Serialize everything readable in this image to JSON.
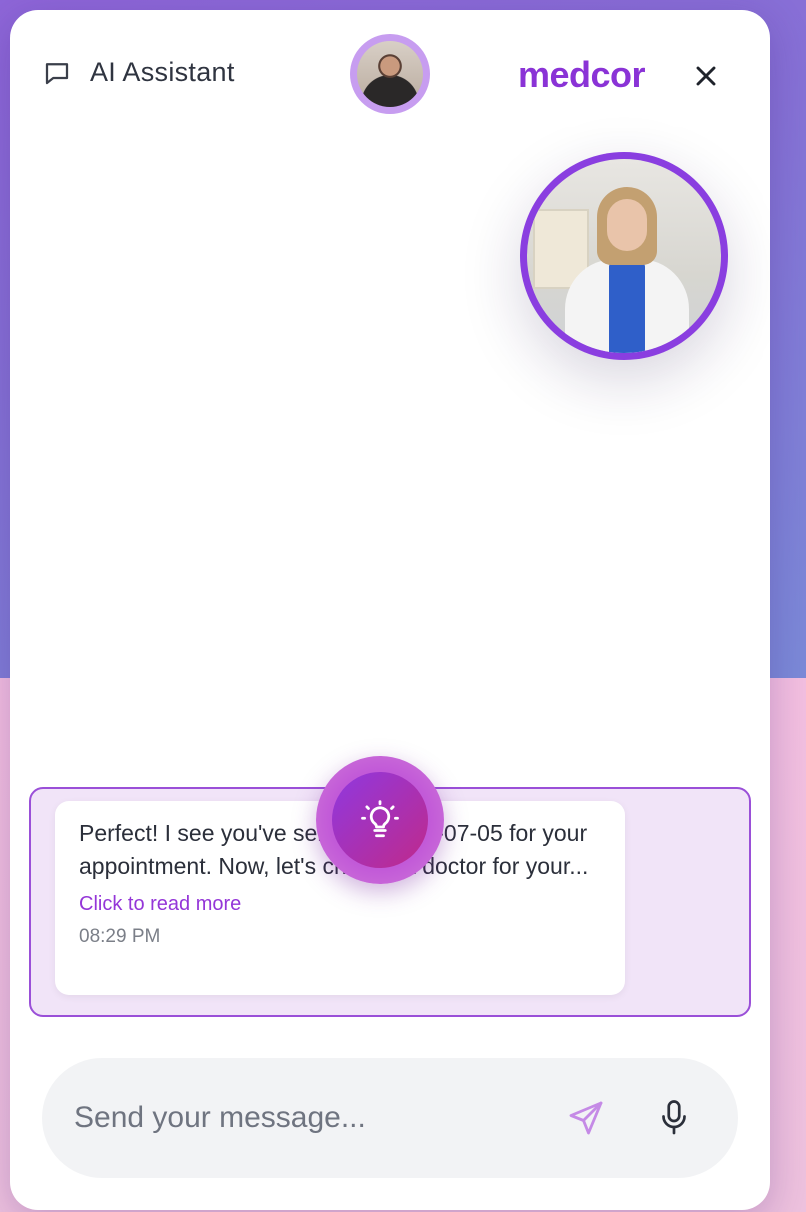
{
  "header": {
    "title": "AI Assistant",
    "brand": "medcor"
  },
  "message": {
    "text": "Perfect! I see you've selected 2025-07-05 for your appointment. Now, let's choose a doctor for your...",
    "read_more": "Click to read more",
    "time": "08:29 PM"
  },
  "composer": {
    "placeholder": "Send your message..."
  },
  "icons": {
    "chat": "chat-bubble-icon",
    "close": "close-icon",
    "bulb": "lightbulb-icon",
    "send": "send-icon",
    "mic": "microphone-icon"
  },
  "colors": {
    "accent": "#8a33d6",
    "bubble_area": "#f1e4f8",
    "input_bg": "#f2f3f5"
  }
}
